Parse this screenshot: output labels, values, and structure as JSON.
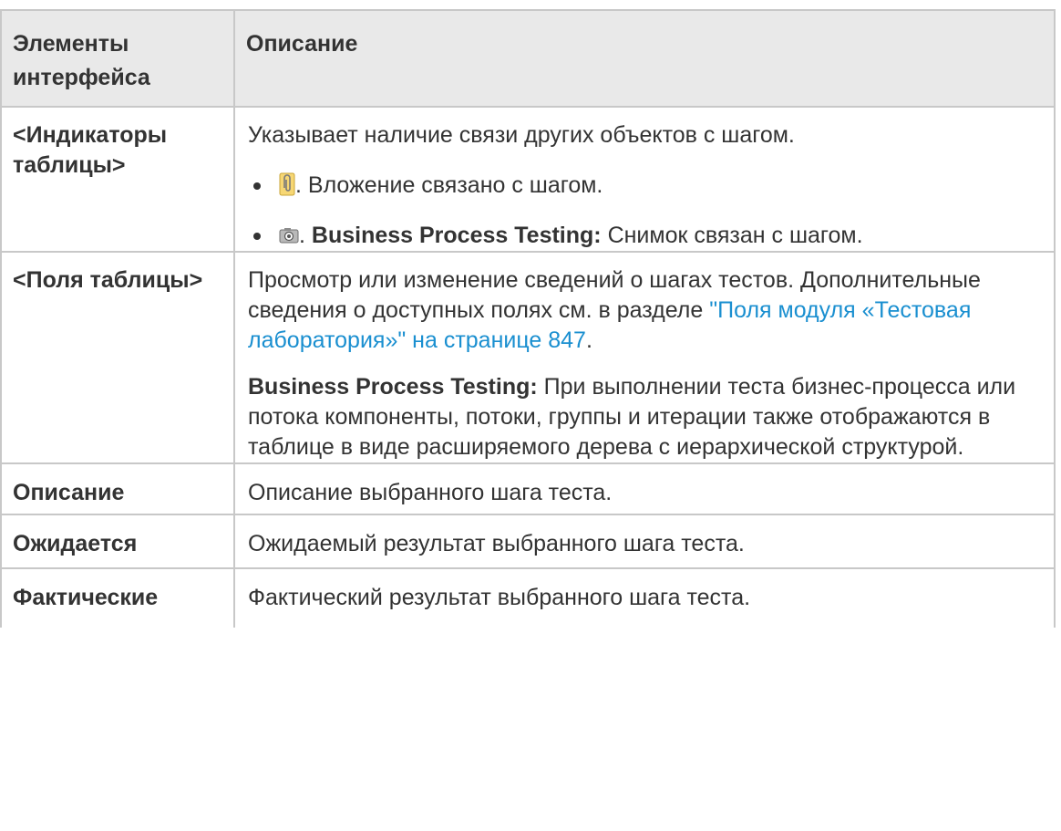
{
  "header": {
    "col1": "Элементы интерфейса",
    "col2": "Описание"
  },
  "rows": {
    "indicators": {
      "label": "<Индикаторы таблицы>",
      "intro": "Указывает наличие связи других объектов с шагом.",
      "bullet1_icon": "paperclip-icon",
      "bullet1_text": ". Вложение связано с шагом.",
      "bullet2_icon": "camera-icon",
      "bullet2_prefix": ".",
      "bullet2_bold": "Business Process Testing:",
      "bullet2_text": "Снимок связан с шагом."
    },
    "fields": {
      "label": "<Поля таблицы>",
      "p1_before": "Просмотр или изменение сведений о шагах тестов. Дополнительные сведения о доступных полях см. в разделе ",
      "p1_link": "\"Поля модуля «Тестовая лаборатория»\" на странице 847",
      "p1_after": ".",
      "p2_bold": "Business Process Testing:",
      "p2_text": "При выполнении теста бизнес-процесса или потока компоненты, потоки, группы и итерации также отображаются в таблице в виде расширяемого дерева с иерархической структурой."
    },
    "description": {
      "label": "Описание",
      "text": "Описание выбранного шага теста."
    },
    "expected": {
      "label": "Ожидается",
      "text": "Ожидаемый результат выбранного шага теста."
    },
    "actual": {
      "label": "Фактические",
      "text": "Фактический результат выбранного шага теста."
    }
  },
  "colors": {
    "header_bg": "#e9e9e9",
    "border": "#c8c8c8",
    "text": "#333333",
    "link": "#1a8fd0"
  }
}
